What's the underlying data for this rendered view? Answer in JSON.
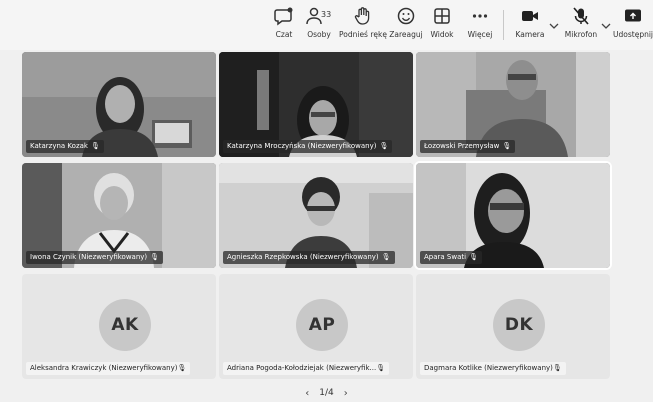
{
  "toolbar": {
    "chat": "Czat",
    "people": "Osoby",
    "people_count": "33",
    "raise": "Podnieś rękę",
    "react": "Zareaguj",
    "view": "Widok",
    "more": "Więcej",
    "camera": "Kamera",
    "mic": "Mikrofon",
    "share": "Udostępnij"
  },
  "participants": [
    {
      "name": "Katarzyna Kozak"
    },
    {
      "name": "Katarzyna Mroczyńska (Niezweryfikowany)"
    },
    {
      "name": "Łozowski Przemysław"
    },
    {
      "name": "Iwona Czynik (Niezweryfikowany)"
    },
    {
      "name": "Agnieszka Rzepkowska (Niezweryfikowany)"
    },
    {
      "name": "Apara Swati"
    },
    {
      "name": "Aleksandra Krawiczyk (Niezweryfikowany)",
      "initials": "AK"
    },
    {
      "name": "Adriana Pogoda-Kołodziejak (Niezweryfik...",
      "initials": "AP"
    },
    {
      "name": "Dagmara Kotlike (Niezweryfikowany)",
      "initials": "DK"
    }
  ],
  "pager": {
    "prev": "‹",
    "page": "1/4",
    "next": "›"
  },
  "icons": {
    "mic": "microphone-icon",
    "camera": "video-camera-icon",
    "share": "share-screen-icon"
  }
}
